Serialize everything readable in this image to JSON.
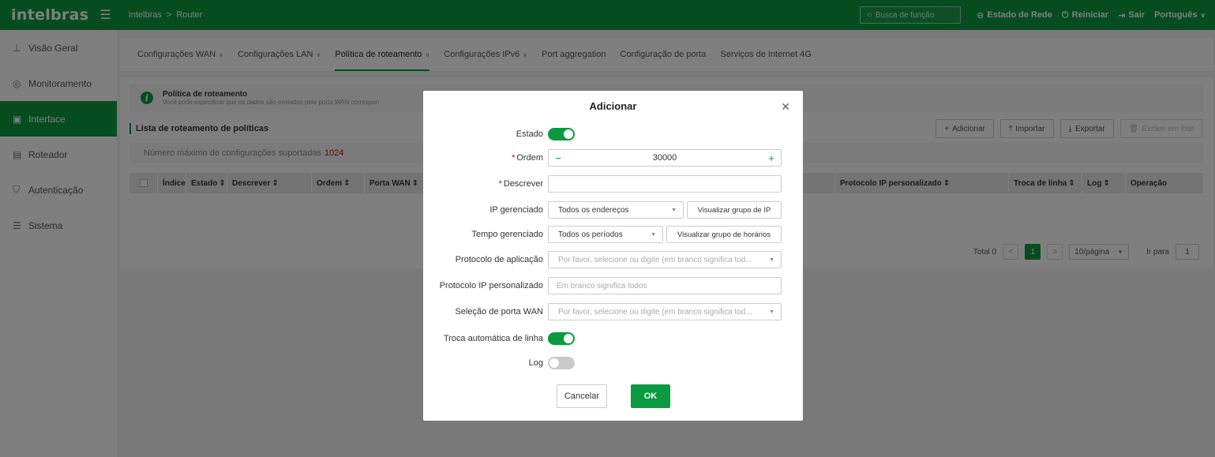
{
  "header": {
    "logo": "intelbras",
    "breadcrumb": [
      "Intelbras",
      "Router"
    ],
    "breadcrumb_sep": ">",
    "search_placeholder": "Busca de função",
    "links": {
      "network_status": "Estado de Rede",
      "restart": "Reiniciar",
      "logout": "Sair",
      "language": "Português"
    },
    "colors": {
      "brand": "#0a9a3f"
    }
  },
  "sidebar": {
    "items": [
      {
        "label": "Visão Geral",
        "icon": "network-tree-icon"
      },
      {
        "label": "Monitoramento",
        "icon": "monitor-icon"
      },
      {
        "label": "Interface",
        "icon": "interface-icon"
      },
      {
        "label": "Roteador",
        "icon": "router-icon"
      },
      {
        "label": "Autenticação",
        "icon": "shield-icon"
      },
      {
        "label": "Sistema",
        "icon": "sliders-icon"
      }
    ],
    "active": "Interface"
  },
  "tabs": [
    {
      "label": "Configurações WAN",
      "dropdown": true
    },
    {
      "label": "Configurações LAN",
      "dropdown": true
    },
    {
      "label": "Política de roteamento",
      "dropdown": true
    },
    {
      "label": "Configurações IPv6",
      "dropdown": true
    },
    {
      "label": "Port aggregation",
      "dropdown": false
    },
    {
      "label": "Configuração de porta",
      "dropdown": false
    },
    {
      "label": "Serviços de Internet 4G",
      "dropdown": false
    }
  ],
  "info": {
    "title": "Política de roteamento",
    "desc": "Você pode especificar que os dados são enviados pela porta WAN correspon"
  },
  "list": {
    "title": "Lista de roteamento de políticas",
    "buttons": {
      "add": "Adicionar",
      "import": "Importar",
      "export": "Exportar",
      "batch_delete": "Excluir em lote"
    },
    "max_text": "Número máximo de configurações suportadas",
    "max_value": "1024",
    "columns": [
      "Índice",
      "Estado",
      "Descrever",
      "Ordem",
      "Porta WAN",
      "Protocolo IP personalizado",
      "Troca de linha",
      "Log",
      "Operação"
    ]
  },
  "pager": {
    "total_label": "Total 0",
    "current_page": "1",
    "page_size": "10/página",
    "goto_label": "Ir para",
    "goto_value": "1"
  },
  "modal": {
    "title": "Adicionar",
    "fields": {
      "estado_label": "Estado",
      "ordem_label": "Ordem",
      "ordem_value": "30000",
      "descrever_label": "Descrever",
      "ip_label": "IP gerenciado",
      "ip_value": "Todos os endereços",
      "ip_btn": "Visualizar grupo de IP",
      "tempo_label": "Tempo gerenciado",
      "tempo_value": "Todos os períodos",
      "tempo_btn": "Visualizar grupo de horários",
      "app_label": "Protocolo de aplicação",
      "app_placeholder": "Por favor, selecione ou digite (em branco significa tod...",
      "proto_label": "Protocolo IP personalizado",
      "proto_placeholder": "Em branco significa todos",
      "wan_label": "Seleção de porta WAN",
      "wan_placeholder": "Por favor, selecione ou digite (em branco significa tod...",
      "troca_label": "Troca automática de linha",
      "log_label": "Log"
    },
    "toggles": {
      "estado": true,
      "troca": true,
      "log": false
    },
    "cancel": "Cancelar",
    "ok": "OK"
  }
}
